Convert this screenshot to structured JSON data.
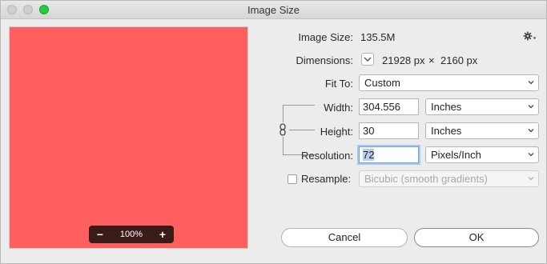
{
  "window": {
    "title": "Image Size"
  },
  "preview": {
    "zoom": "100%",
    "minus": "−",
    "plus": "+",
    "fill_color": "#ff5f5f"
  },
  "info": {
    "image_size_label": "Image Size:",
    "image_size_value": "135.5M",
    "dimensions_label": "Dimensions:",
    "dim_width": "21928 px",
    "dim_x": "×",
    "dim_height": "2160 px"
  },
  "fit_to": {
    "label": "Fit To:",
    "value": "Custom"
  },
  "width": {
    "label": "Width:",
    "value": "304.556",
    "unit": "Inches"
  },
  "height": {
    "label": "Height:",
    "value": "30",
    "unit": "Inches"
  },
  "resolution": {
    "label": "Resolution:",
    "value": "72",
    "unit": "Pixels/Inch"
  },
  "resample": {
    "label": "Resample:",
    "checked": false,
    "method": "Bicubic (smooth gradients)"
  },
  "buttons": {
    "cancel": "Cancel",
    "ok": "OK"
  },
  "colors": {
    "accent_focus": "#6aa2e6",
    "zoom_button": "#29c940"
  }
}
